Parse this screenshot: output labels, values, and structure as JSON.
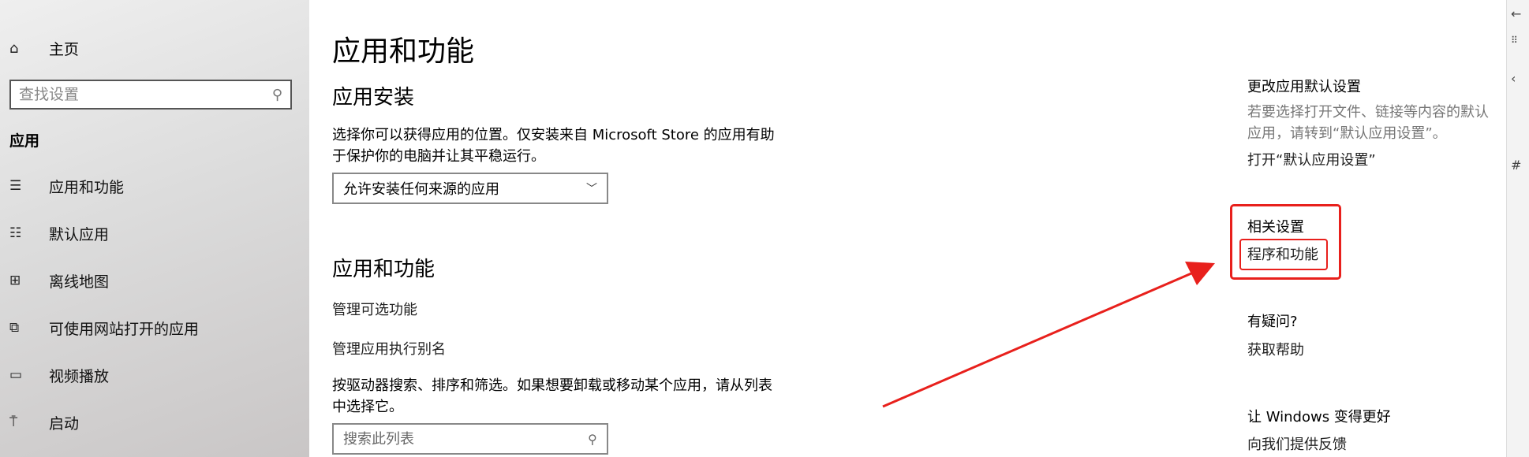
{
  "nav": {
    "home_label": "主页",
    "search_placeholder": "查找设置",
    "section_label": "应用",
    "items": [
      {
        "label": "应用和功能",
        "icon": "apps-features-icon"
      },
      {
        "label": "默认应用",
        "icon": "default-apps-icon"
      },
      {
        "label": "离线地图",
        "icon": "offline-maps-icon"
      },
      {
        "label": "可使用网站打开的应用",
        "icon": "apps-for-websites-icon"
      },
      {
        "label": "视频播放",
        "icon": "video-playback-icon"
      },
      {
        "label": "启动",
        "icon": "startup-icon"
      }
    ]
  },
  "main": {
    "title": "应用和功能",
    "install": {
      "heading": "应用安装",
      "description": "选择你可以获得应用的位置。仅安装来自 Microsoft Store 的应用有助于保护你的电脑并让其平稳运行。",
      "dropdown_value": "允许安装任何来源的应用"
    },
    "apps": {
      "heading": "应用和功能",
      "optional_features": "管理可选功能",
      "exec_aliases": "管理应用执行别名",
      "description": "按驱动器搜索、排序和筛选。如果想要卸载或移动某个应用，请从列表中选择它。",
      "search_placeholder": "搜索此列表"
    }
  },
  "related": {
    "default_heading": "更改应用默认设置",
    "default_desc": "若要选择打开文件、链接等内容的默认应用，请转到“默认应用设置”。",
    "default_link": "打开“默认应用设置”",
    "related_heading": "相关设置",
    "programs_link": "程序和功能",
    "question_heading": "有疑问?",
    "help_link": "获取帮助",
    "improve_heading": "让 Windows 变得更好",
    "feedback_link": "向我们提供反馈"
  },
  "annotation_color": "#e8201c"
}
